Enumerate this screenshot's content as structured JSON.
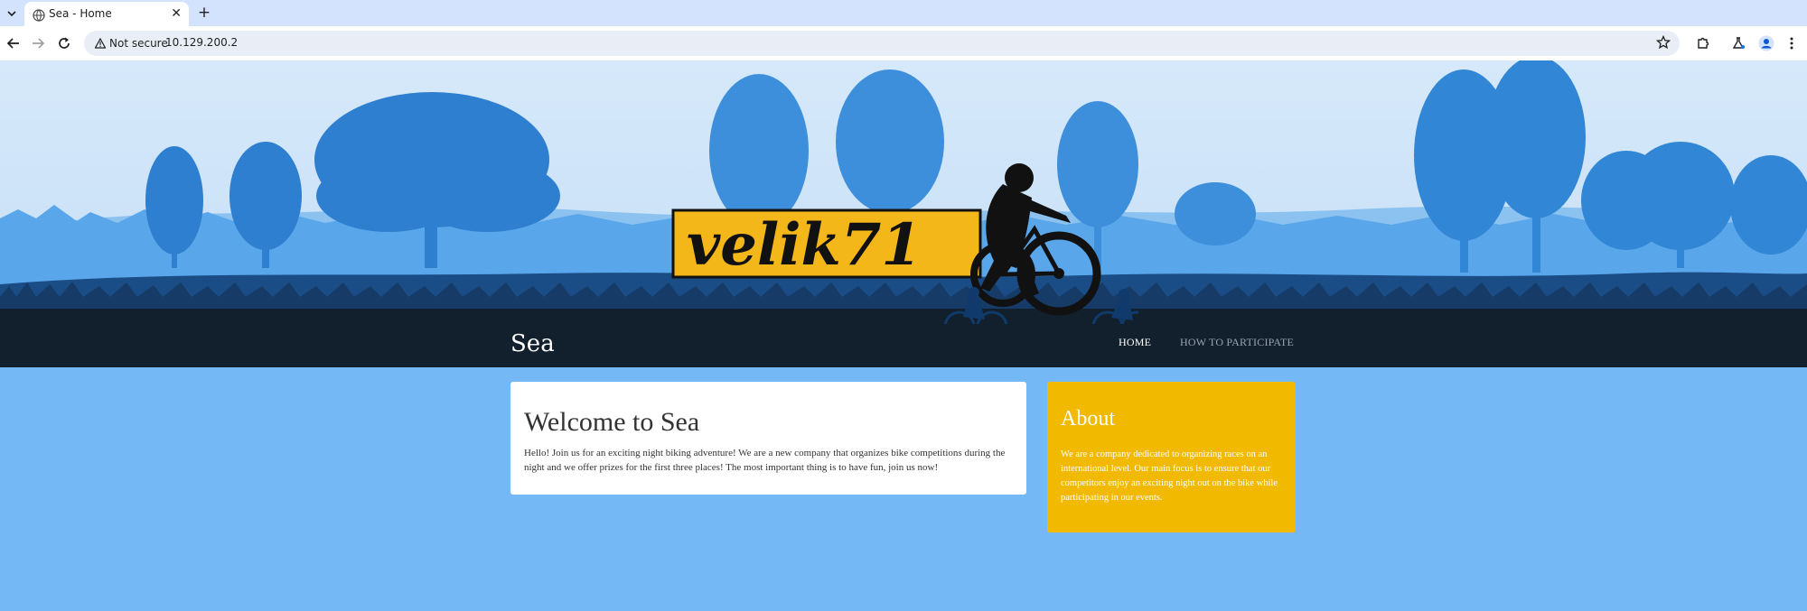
{
  "browser": {
    "tab": {
      "title": "Sea - Home",
      "close": "✕"
    },
    "new_tab": "+",
    "omnibox": {
      "security_label": "Not secure",
      "url": "10.129.200.2"
    }
  },
  "banner": {
    "logo_text": "velik71",
    "logo_color": "#f4b719"
  },
  "navbar": {
    "brand": "Sea",
    "links": [
      {
        "label": "HOME",
        "active": true
      },
      {
        "label": "HOW TO PARTICIPATE",
        "active": false
      }
    ]
  },
  "welcome": {
    "title": "Welcome to Sea",
    "text": "Hello! Join us for an exciting night biking adventure! We are a new company that organizes bike competitions during the night and we offer prizes for the first three places! The most important thing is to have fun, join us now!"
  },
  "about": {
    "title": "About",
    "text": "We are a company dedicated to organizing races on an international level. Our main focus is to ensure that our competitors enjoy an exciting night out on the bike while participating in our events.",
    "color": "#f1b900"
  },
  "colors": {
    "page_bg": "#74b9f5",
    "navbar_bg": "#12202e",
    "tabstrip_bg": "#d3e3fd"
  }
}
